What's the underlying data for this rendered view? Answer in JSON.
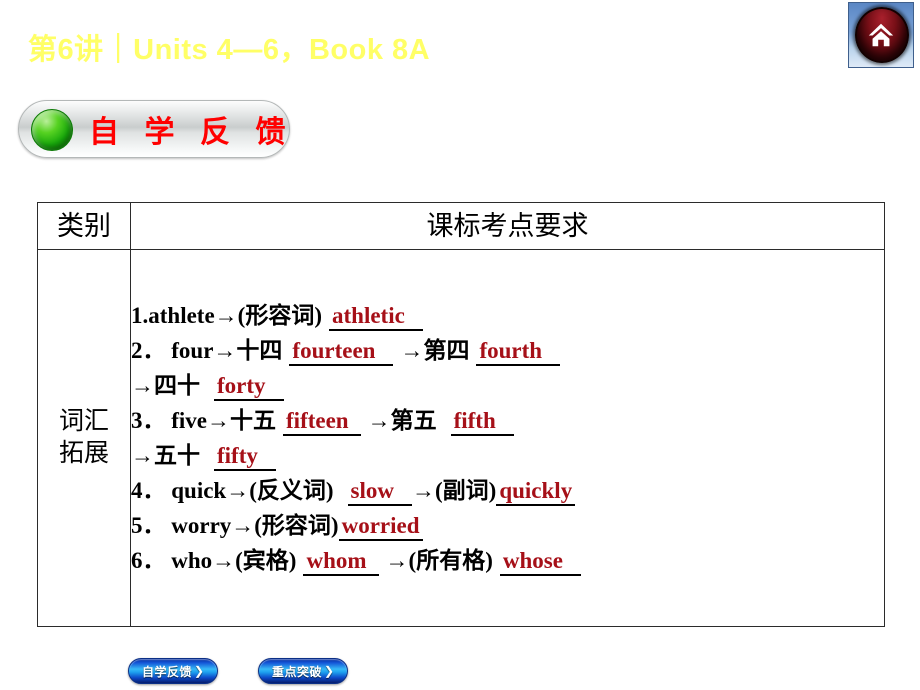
{
  "header": {
    "title": "第6讲｜Units 4—6，Book 8A",
    "title_color": "#ffff66",
    "home_icon": "home-icon"
  },
  "section_banner": {
    "label": "自 学 反 馈",
    "label_color": "#ff0000",
    "bullet_icon": "green-bullet-icon"
  },
  "table": {
    "headers": {
      "category": "类别",
      "requirement": "课标考点要求"
    },
    "category_label_line1": "词汇",
    "category_label_line2": "拓展",
    "answer_color": "#a61018",
    "rows": [
      {
        "num": "1.",
        "segments": [
          {
            "type": "text",
            "value": "athlete→(形容词)"
          },
          {
            "type": "answer",
            "value": "athletic"
          }
        ]
      },
      {
        "num": "2．",
        "segments": [
          {
            "type": "text",
            "value": "four→十四"
          },
          {
            "type": "answer",
            "value": "fourteen"
          },
          {
            "type": "text",
            "value": "→第四"
          },
          {
            "type": "answer",
            "value": "fourth"
          }
        ]
      },
      {
        "num": "",
        "segments": [
          {
            "type": "text",
            "value": "→四十"
          },
          {
            "type": "answer",
            "value": "forty"
          }
        ]
      },
      {
        "num": "3．",
        "segments": [
          {
            "type": "text",
            "value": "five→十五"
          },
          {
            "type": "answer",
            "value": "fifteen"
          },
          {
            "type": "text",
            "value": "→第五"
          },
          {
            "type": "answer",
            "value": "fifth"
          }
        ]
      },
      {
        "num": "",
        "segments": [
          {
            "type": "text",
            "value": "→五十"
          },
          {
            "type": "answer",
            "value": "fifty"
          }
        ]
      },
      {
        "num": "4．",
        "segments": [
          {
            "type": "text",
            "value": "quick→(反义词)"
          },
          {
            "type": "answer",
            "value": "slow"
          },
          {
            "type": "text",
            "value": "→(副词)"
          },
          {
            "type": "answer",
            "value": "quickly"
          }
        ]
      },
      {
        "num": "5．",
        "segments": [
          {
            "type": "text",
            "value": "worry→(形容词)"
          },
          {
            "type": "answer",
            "value": "worried"
          }
        ]
      },
      {
        "num": "6．",
        "segments": [
          {
            "type": "text",
            "value": "who→(宾格)"
          },
          {
            "type": "answer",
            "value": "whom"
          },
          {
            "type": "text",
            "value": "→(所有格)"
          },
          {
            "type": "answer",
            "value": "whose"
          }
        ]
      }
    ]
  },
  "lines": {
    "l1": "1.athlete→(形容词)",
    "l1a": "athletic",
    "l2": "2．  four→十四",
    "l2a": "fourteen",
    "l2b": "→第四",
    "l2c": "fourth",
    "l3": "→四十",
    "l3a": "forty",
    "l4": "3．  five→十五",
    "l4a": "fifteen",
    "l4b": "→第五",
    "l4c": "fifth",
    "l5": "→五十",
    "l5a": "fifty",
    "l6": "4．  quick→(反义词)",
    "l6a": "slow",
    "l6b": "→(副词)",
    "l6c": "quickly",
    "l7": "5．  worry→(形容词)",
    "l7a": "worried",
    "l8": "6．  who→(宾格)",
    "l8a": "whom",
    "l8b": "→(所有格)",
    "l8c": "whose"
  },
  "footer": {
    "buttons": [
      {
        "label": "自学反馈",
        "arrow": "❯"
      },
      {
        "label": "重点突破",
        "arrow": "❯"
      }
    ],
    "btn1_label": "自学反馈",
    "btn1_arrow": "❯",
    "btn2_label": "重点突破",
    "btn2_arrow": "❯"
  }
}
